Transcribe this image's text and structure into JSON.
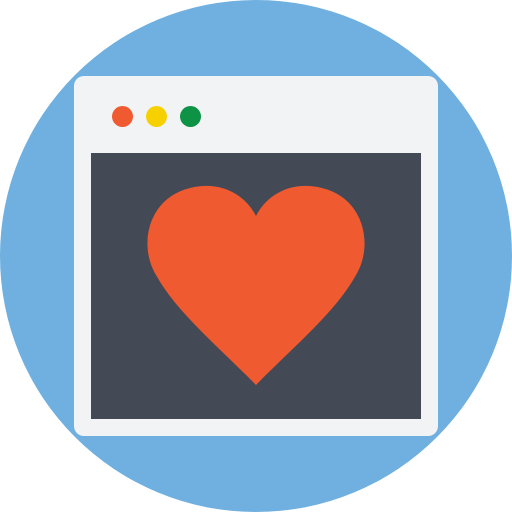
{
  "icon": {
    "name": "browser-window-heart-icon",
    "colors": {
      "background_circle": "#6FB0E0",
      "window_frame": "#F2F3F5",
      "content_area": "#434955",
      "heart": "#F05A30",
      "dot_red": "#F05A30",
      "dot_yellow": "#F7D000",
      "dot_green": "#0E9245"
    },
    "window_dots": [
      "close-dot",
      "minimize-dot",
      "maximize-dot"
    ]
  }
}
